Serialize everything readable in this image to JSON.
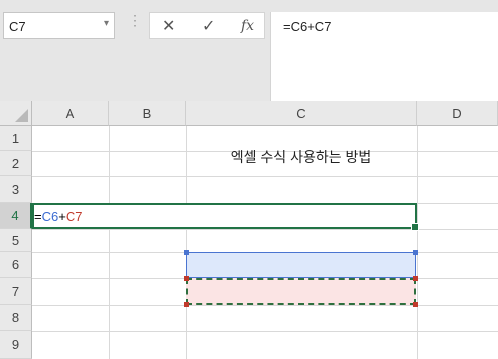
{
  "formula_bar": {
    "name_box": "C7",
    "name_box_dropdown": "▾",
    "separator": "⋮",
    "cancel_glyph": "✕",
    "enter_glyph": "✓",
    "fx_glyph": "fx",
    "formula": "=C6+C7"
  },
  "columns": [
    "A",
    "B",
    "C",
    "D"
  ],
  "rows": [
    "1",
    "2",
    "3",
    "4",
    "5",
    "6",
    "7",
    "8",
    "9"
  ],
  "cells": {
    "title": "엑셀 수식 사용하는 방법",
    "editing": {
      "eq": "=",
      "ref1": "C6",
      "plus": "+",
      "ref2": "C7"
    }
  },
  "colors": {
    "accent": "#217346",
    "ref_blue": "#3a6bd1",
    "ref_red": "#c0392b"
  }
}
